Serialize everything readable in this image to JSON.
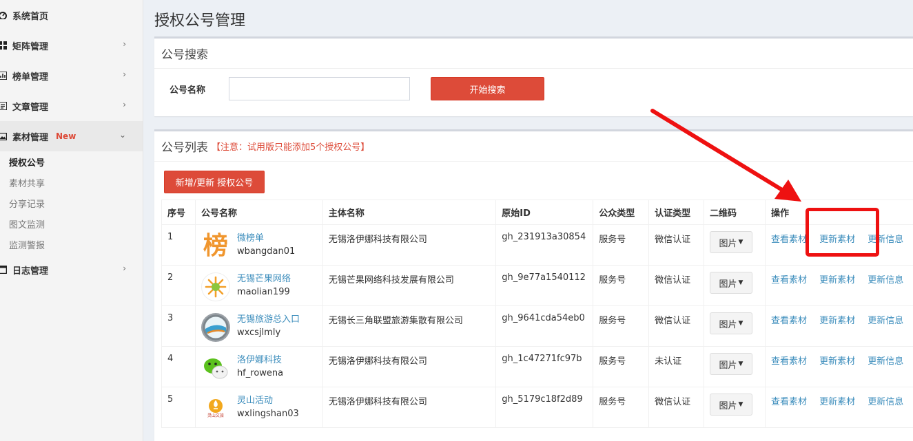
{
  "sidebar": {
    "items": [
      {
        "label": "系统首页",
        "icon": "dashboard-icon"
      },
      {
        "label": "矩阵管理",
        "icon": "grid-icon"
      },
      {
        "label": "榜单管理",
        "icon": "rank-icon"
      },
      {
        "label": "文章管理",
        "icon": "article-icon"
      },
      {
        "label": "素材管理",
        "icon": "image-icon",
        "badge": "New"
      },
      {
        "label": "日志管理",
        "icon": "log-icon"
      }
    ],
    "subitems": [
      "授权公号",
      "素材共享",
      "分享记录",
      "图文监测",
      "监测警报"
    ],
    "active_sub": "授权公号"
  },
  "page": {
    "title": "授权公号管理"
  },
  "search": {
    "title": "公号搜索",
    "label": "公号名称",
    "value": "",
    "button": "开始搜索"
  },
  "list": {
    "title": "公号列表",
    "note": "【注意：试用版只能添加5个授权公号】",
    "add_button": "新增/更新 授权公号",
    "columns": [
      "序号",
      "公号名称",
      "主体名称",
      "原始ID",
      "公众类型",
      "认证类型",
      "二维码",
      "操作"
    ],
    "rows": [
      {
        "no": "1",
        "name": "微榜单",
        "account": "wbangdan01",
        "entity": "无锡洛伊娜科技有限公司",
        "raw_id": "gh_231913a30854",
        "type": "服务号",
        "verify": "微信认证",
        "qr": "图片",
        "ops": [
          "查看素材",
          "更新素材",
          "更新信息"
        ]
      },
      {
        "no": "2",
        "name": "无锡芒果网络",
        "account": "maolian199",
        "entity": "无锡芒果网络科技发展有限公司",
        "raw_id": "gh_9e77a1540112",
        "type": "服务号",
        "verify": "微信认证",
        "qr": "图片",
        "ops": [
          "查看素材",
          "更新素材",
          "更新信息"
        ]
      },
      {
        "no": "3",
        "name": "无锡旅游总入口",
        "account": "wxcsjlmly",
        "entity": "无锡长三角联盟旅游集散有限公司",
        "raw_id": "gh_9641cda54eb0",
        "type": "服务号",
        "verify": "微信认证",
        "qr": "图片",
        "ops": [
          "查看素材",
          "更新素材",
          "更新信息"
        ]
      },
      {
        "no": "4",
        "name": "洛伊娜科技",
        "account": "hf_rowena",
        "entity": "无锡洛伊娜科技有限公司",
        "raw_id": "gh_1c47271fc97b",
        "type": "服务号",
        "verify": "未认证",
        "qr": "图片",
        "ops": [
          "查看素材",
          "更新素材",
          "更新信息"
        ]
      },
      {
        "no": "5",
        "name": "灵山活动",
        "account": "wxlingshan03",
        "entity": "无锡洛伊娜科技有限公司",
        "raw_id": "gh_5179c18f2d89",
        "type": "服务号",
        "verify": "微信认证",
        "qr": "图片",
        "ops": [
          "查看素材",
          "更新素材",
          "更新信息"
        ]
      }
    ]
  },
  "avatars": {
    "row1": {
      "glyph": "榜",
      "color": "#f0962e"
    },
    "row5": {
      "text": "灵山文旅"
    }
  },
  "colors": {
    "accent_red": "#dd4b39",
    "link_blue": "#3c8dbc",
    "annotation_red": "#ee1111"
  }
}
